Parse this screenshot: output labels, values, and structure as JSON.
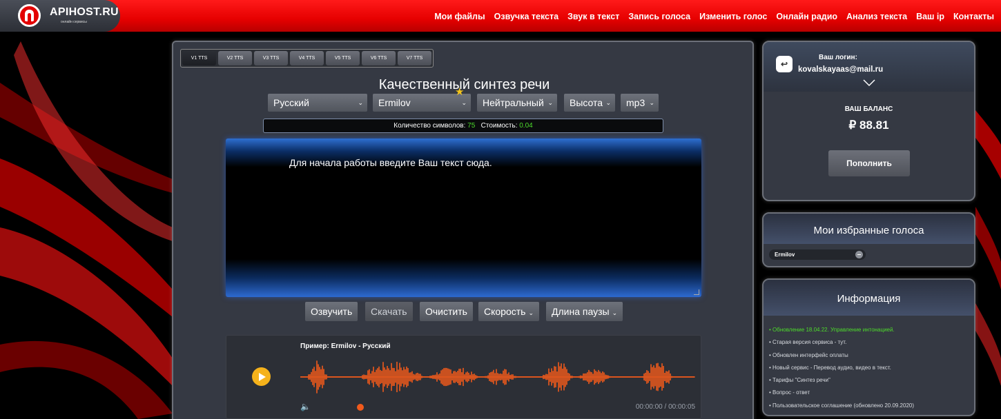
{
  "header": {
    "logo_text": "APIHOST.RU",
    "logo_sub": "онлайн сервисы",
    "nav": [
      "Мои файлы",
      "Озвучка текста",
      "Звук в текст",
      "Запись голоса",
      "Изменить голос",
      "Онлайн радио",
      "Анализ текста",
      "Ваш ip",
      "Контакты"
    ]
  },
  "tts_tabs": [
    "V1 TTS",
    "V2 TTS",
    "V3 TTS",
    "V4 TTS",
    "V5 TTS",
    "V6 TTS",
    "V7 TTS"
  ],
  "main": {
    "heading": "Качественный синтез речи",
    "selects": {
      "language": "Русский",
      "voice": "Ermilov",
      "emotion": "Нейтральный",
      "pitch": "Высота",
      "format": "mp3"
    },
    "counter": {
      "chars_label": "Количество символов:",
      "chars_value": "75",
      "cost_label": "Стоимость:",
      "cost_value": "0.04"
    },
    "textarea_placeholder": "Для начала работы введите Ваш текст сюда.",
    "buttons": {
      "speak": "Озвучить",
      "download": "Скачать",
      "clear": "Очистить",
      "speed": "Скорость",
      "pause": "Длина паузы"
    },
    "player": {
      "title": "Пример: Ermilov - Русский",
      "time": "00:00:00 / 00:00:05",
      "progress": 0.0
    }
  },
  "account": {
    "login_label": "Ваш логин:",
    "email": "kovalskayaas@mail.ru",
    "balance_label": "ВАШ БАЛАНС",
    "balance_value": "₽ 88.81",
    "topup_label": "Пополнить"
  },
  "favorites": {
    "title": "Мои избранные голоса",
    "items": [
      "Ermilov"
    ]
  },
  "info": {
    "title": "Информация",
    "items": [
      "Обновление 18.04.22. Управление интонацией.",
      "Старая версия сервиса - тут.",
      "Обновлен интерфейс оплаты",
      "Новый сервис - Перевод аудио, видео в текст.",
      "Тарифы \"Синтез речи\"",
      "Вопрос - ответ",
      "Пользовательское соглашение (обновлено 20.09.2020)"
    ]
  },
  "colors": {
    "brand_red": "#e30000",
    "panel_bg": "#353943",
    "accent_green": "#4ddb2b",
    "waveform": "#f15a1c",
    "play_button": "#f5b21b"
  }
}
